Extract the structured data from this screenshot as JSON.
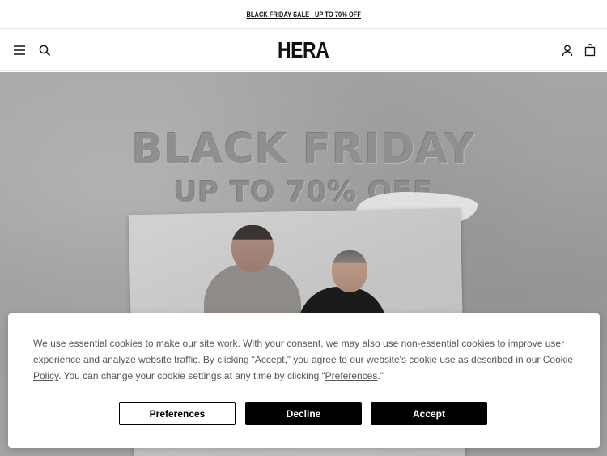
{
  "announcement": {
    "text": "BLACK FRIDAY SALE - UP TO 70% OFF"
  },
  "header": {
    "logo": "HERA",
    "icons": [
      "menu-icon",
      "search-icon",
      "account-icon",
      "bag-icon"
    ]
  },
  "hero": {
    "title": "BLACK FRIDAY",
    "subtitle": "UP TO 70% OFF"
  },
  "cookie_banner": {
    "text_part1": "We use essential cookies to make our site work. With your consent, we may also use non-essential cookies to improve user experience and analyze website traffic. By clicking “Accept,” you agree to our website's cookie use as described in our ",
    "policy_link": "Cookie Policy",
    "text_part2": ". You can change your cookie settings at any time by clicking “",
    "preferences_link": "Preferences",
    "text_part3": ".”",
    "buttons": {
      "preferences": "Preferences",
      "decline": "Decline",
      "accept": "Accept"
    }
  }
}
